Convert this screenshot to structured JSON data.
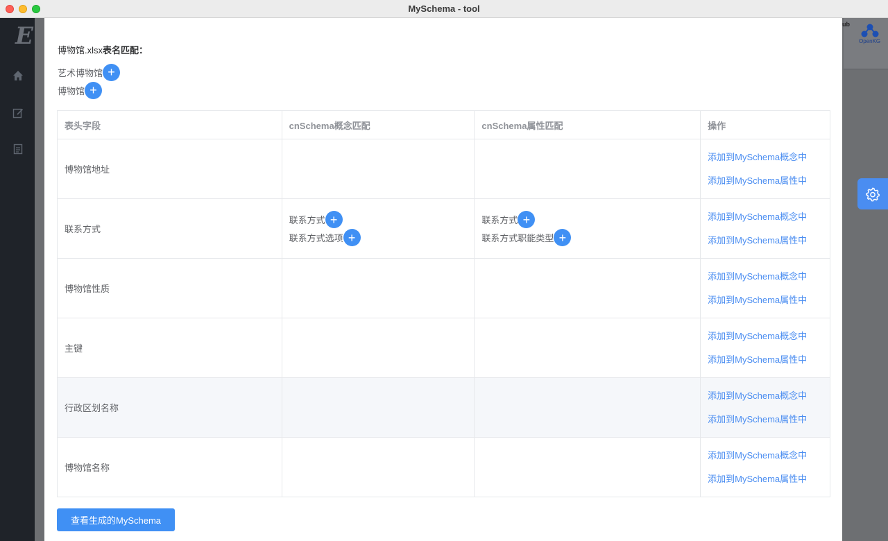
{
  "window": {
    "title": "MySchema - tool"
  },
  "app": {
    "logo_text": "E",
    "header_right_text": "ub",
    "openkg_label": "OpenKG"
  },
  "dialog": {
    "file_name": "博物馆.xlsx",
    "file_heading_suffix": "表名匹配：",
    "table_name_matches": [
      "艺术博物馆",
      "博物馆"
    ],
    "table": {
      "headers": [
        "表头字段",
        "cnSchema概念匹配",
        "cnSchema属性匹配",
        "操作"
      ],
      "rows": [
        {
          "field": "博物馆地址",
          "concepts": [],
          "properties": [],
          "action_concept": "添加到MySchema概念中",
          "action_property": "添加到MySchema属性中"
        },
        {
          "field": "联系方式",
          "concepts": [
            "联系方式",
            "联系方式选项"
          ],
          "properties": [
            "联系方式",
            "联系方式职能类型"
          ],
          "action_concept": "添加到MySchema概念中",
          "action_property": "添加到MySchema属性中"
        },
        {
          "field": "博物馆性质",
          "concepts": [],
          "properties": [],
          "action_concept": "添加到MySchema概念中",
          "action_property": "添加到MySchema属性中"
        },
        {
          "field": "主键",
          "concepts": [],
          "properties": [],
          "action_concept": "添加到MySchema概念中",
          "action_property": "添加到MySchema属性中"
        },
        {
          "field": "行政区划名称",
          "concepts": [],
          "properties": [],
          "action_concept": "添加到MySchema概念中",
          "action_property": "添加到MySchema属性中",
          "highlighted": true
        },
        {
          "field": "博物馆名称",
          "concepts": [],
          "properties": [],
          "action_concept": "添加到MySchema概念中",
          "action_property": "添加到MySchema属性中"
        }
      ]
    },
    "view_button_label": "查看生成的MySchema",
    "plus_symbol": "+"
  },
  "colors": {
    "primary": "#4090f4",
    "link": "#4a8df1",
    "sidebar": "#1f2329"
  },
  "icons": {
    "sidebar": [
      "home-icon",
      "edit-icon",
      "document-icon"
    ],
    "settings": "gear-icon"
  }
}
